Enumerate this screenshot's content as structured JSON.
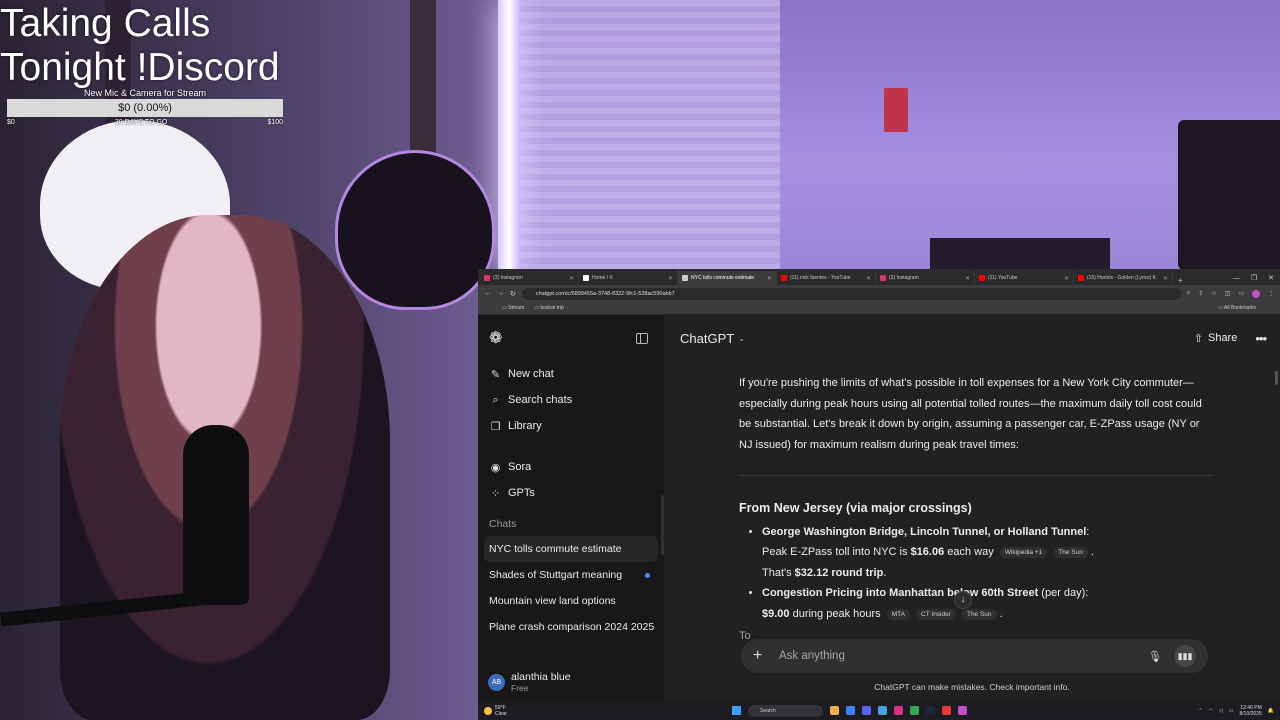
{
  "overlay": {
    "title_line1": "Taking Calls",
    "title_line2": "Tonight !Discord",
    "goal": {
      "label": "New Mic & Camera for Stream",
      "amount_text": "$0 (0.00%)",
      "progress_percent": 0,
      "min_label": "$0",
      "days_label": "30 DAYS TO GO",
      "max_label": "$100",
      "fill_color": "#66c266"
    }
  },
  "browser": {
    "tabs": [
      {
        "label": "(3) Instagram",
        "favicon_color": "#e1306c",
        "active": false
      },
      {
        "label": "Home / X",
        "favicon_color": "#ffffff",
        "active": false
      },
      {
        "label": "NYC tolls commute estimate",
        "favicon_color": "#cccccc",
        "active": true
      },
      {
        "label": "(11) nick fuentes - YouTube",
        "favicon_color": "#ff0000",
        "active": false
      },
      {
        "label": "(3) Instagram",
        "favicon_color": "#e1306c",
        "active": false
      },
      {
        "label": "(11) YouTube",
        "favicon_color": "#ff0000",
        "active": false
      },
      {
        "label": "(15) Huntrix - Golden (Lyrics) K",
        "favicon_color": "#ff0000",
        "active": false
      }
    ],
    "url": "chatgpt.com/c/6899455a-3748-8322-9fc1-528ac590abb7",
    "bookmarks": [
      "Stream",
      "boston trip"
    ],
    "all_bookmarks": "All Bookmarks"
  },
  "sidebar": {
    "nav": [
      {
        "label": "New chat",
        "icon": "edit-icon",
        "glyph": "✎"
      },
      {
        "label": "Search chats",
        "icon": "search-icon",
        "glyph": "⌕"
      },
      {
        "label": "Library",
        "icon": "library-icon",
        "glyph": "❐"
      }
    ],
    "nav2": [
      {
        "label": "Sora",
        "icon": "sora-icon",
        "glyph": "◉"
      },
      {
        "label": "GPTs",
        "icon": "gpts-icon",
        "glyph": "⁘"
      }
    ],
    "chats_heading": "Chats",
    "chats": [
      {
        "label": "NYC tolls commute estimate",
        "active": true,
        "unread": false
      },
      {
        "label": "Shades of Stuttgart meaning",
        "active": false,
        "unread": true
      },
      {
        "label": "Mountain view land options",
        "active": false,
        "unread": false
      },
      {
        "label": "Plane crash comparison 2024 2025",
        "active": false,
        "unread": false
      }
    ],
    "user": {
      "initials": "AB",
      "name": "alanthia blue",
      "plan": "Free"
    }
  },
  "main": {
    "model": "ChatGPT",
    "share_label": "Share",
    "intro": "If you're pushing the limits of what's possible in toll expenses for a New York City commuter—especially during peak hours using all potential tolled routes—the maximum daily toll cost could be substantial. Let's break it down by origin, assuming a passenger car, E-ZPass usage (NY or NJ issued) for maximum realism during peak travel times:",
    "section_heading": "From New Jersey (via major crossings)",
    "bullet1": {
      "bold": "George Washington Bridge, Lincoln Tunnel, or Holland Tunnel",
      "after_bold": ":",
      "line2_pre": "Peak E-ZPass toll into NYC is ",
      "line2_bold": "$16.06",
      "line2_post": " each way",
      "chips": [
        "Wikipedia +1",
        "The Sun"
      ],
      "line3_pre": "That's ",
      "line3_bold": "$32.12 round trip",
      "line3_post": "."
    },
    "bullet2": {
      "bold": "Congestion Pricing into Manhattan below 60th Street",
      "after_bold": " (per day):",
      "line2_bold": "$9.00",
      "line2_post": " during peak hours",
      "chips": [
        "MTA",
        "CT Insider",
        "The Sun"
      ]
    },
    "cut_text": "To",
    "composer_placeholder": "Ask anything",
    "disclaimer": "ChatGPT can make mistakes. Check important info."
  },
  "taskbar": {
    "weather_temp": "59°F",
    "weather_desc": "Clear",
    "search_placeholder": "Search",
    "time": "12:46 PM",
    "date": "8/10/2025"
  }
}
